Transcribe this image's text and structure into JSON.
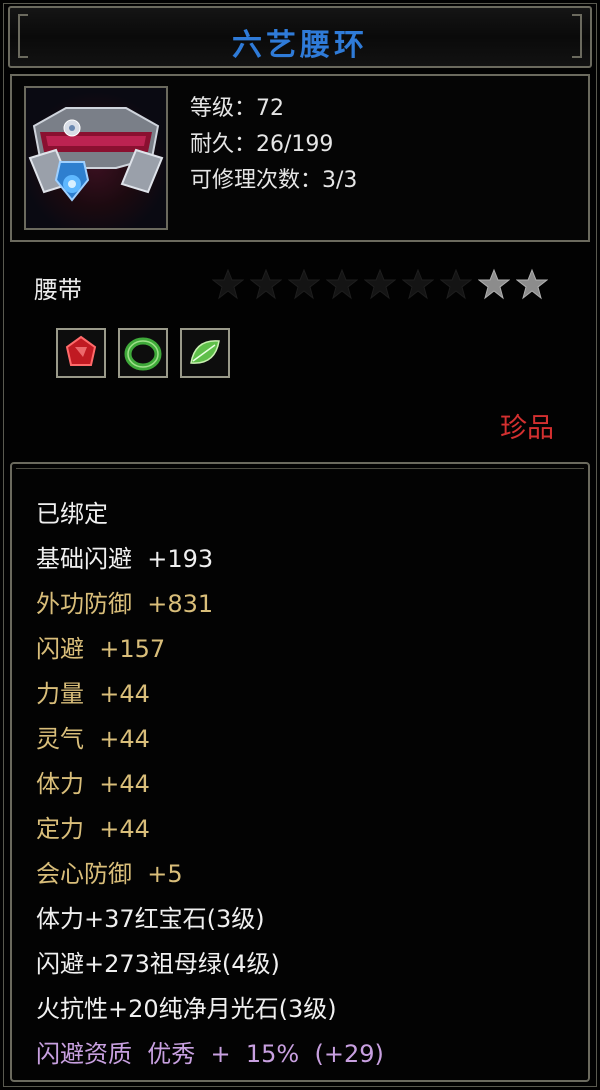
{
  "title": "六艺腰环",
  "colors": {
    "title": "#2f7bd8",
    "frame": "#6b6a5e",
    "white_text": "#f0f0f0",
    "gold_text": "#d9be7a",
    "purple_text": "#c8a0e0",
    "rarity_red": "#d43030"
  },
  "header": {
    "icon": "belt-item-icon",
    "level": "等级：72",
    "durability": "耐久：26/199",
    "repairs": "可修理次数：3/3"
  },
  "item_type": "腰带",
  "stars": {
    "total": 9,
    "filled": 2
  },
  "gems": [
    {
      "icon": "red-ruby-gem-icon",
      "color": "#c01a22"
    },
    {
      "icon": "green-jade-ring-icon",
      "color": "#3fa93a"
    },
    {
      "icon": "green-leaf-gem-icon",
      "color": "#5fbf4a"
    }
  ],
  "rarity": "珍品",
  "attributes": [
    {
      "text": "已绑定",
      "color": "white"
    },
    {
      "text": "基础闪避  +193",
      "color": "white"
    },
    {
      "text": "外功防御  +831",
      "color": "gold"
    },
    {
      "text": "闪避  +157",
      "color": "gold"
    },
    {
      "text": "力量  +44",
      "color": "gold"
    },
    {
      "text": "灵气  +44",
      "color": "gold"
    },
    {
      "text": "体力  +44",
      "color": "gold"
    },
    {
      "text": "定力  +44",
      "color": "gold"
    },
    {
      "text": "会心防御  +5",
      "color": "gold"
    },
    {
      "text": "体力+37红宝石(3级)",
      "color": "white"
    },
    {
      "text": "闪避+273祖母绿(4级)",
      "color": "white"
    },
    {
      "text": "火抗性+20纯净月光石(3级)",
      "color": "white"
    },
    {
      "text": "闪避资质  优秀  +  15%  (+29)",
      "color": "purple"
    }
  ]
}
